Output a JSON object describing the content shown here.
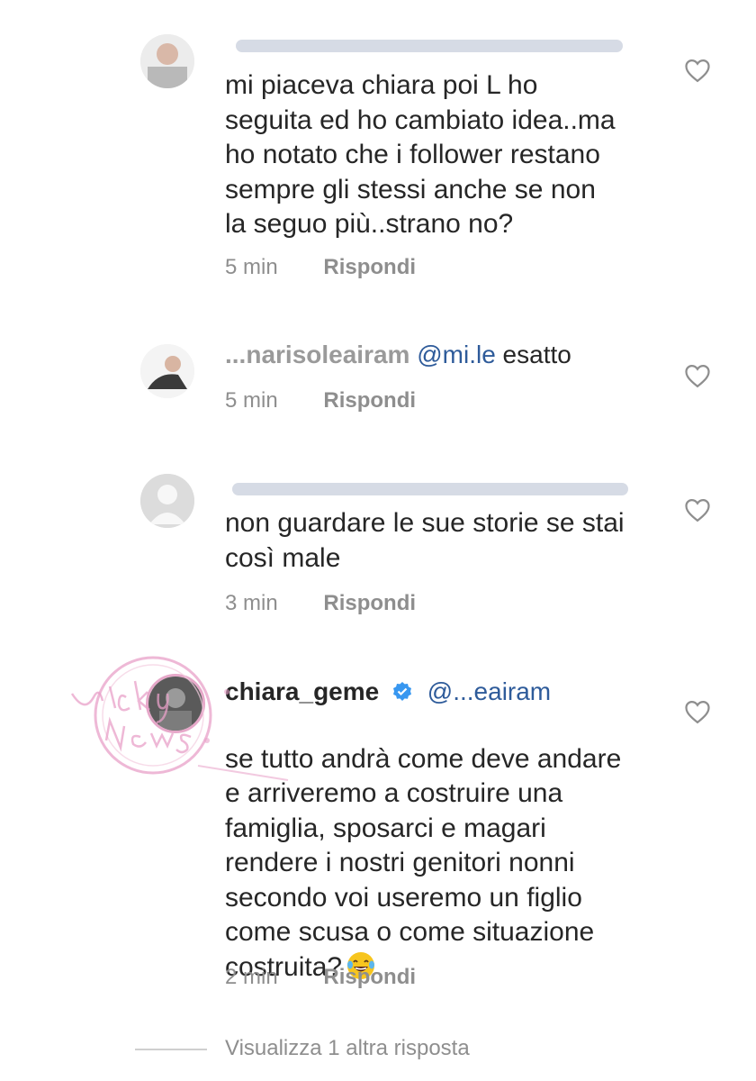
{
  "comments": [
    {
      "text": "mi piaceva chiara poi L ho\nseguita ed ho cambiato idea..ma\nho notato che i follower restano\nsempre gli stessi anche se non\nla seguo più..strano no?",
      "time": "5 min",
      "reply_label": "Rispondi"
    },
    {
      "username": "...narisoleairam",
      "mention": "@mi.le",
      "text": "esatto",
      "time": "5 min",
      "reply_label": "Rispondi"
    },
    {
      "text": "non guardare le sue storie se stai\ncosì male",
      "time": "3 min",
      "reply_label": "Rispondi"
    },
    {
      "username": "chiara_geme",
      "mention": "@...eairam",
      "text": "se tutto andrà come deve andare\ne arriveremo a costruire una\nfamiglia, sposarci e magari\nrendere i nostri genitori nonni\nsecondo voi useremo un figlio\ncome scusa o come situazione\ncostruita?",
      "time": "2 min",
      "reply_label": "Rispondi"
    }
  ],
  "view_more": "Visualizza 1 altra risposta",
  "watermark_text": "Vicky News",
  "colors": {
    "text": "#262626",
    "muted": "#8e8e8e",
    "mention": "#2e5b9a",
    "verified": "#3897f0",
    "watermark": "#e8a0c8"
  },
  "icons": {
    "like": "heart-outline-icon",
    "verified": "verified-badge-icon",
    "emoji": "laughing-tears-emoji-icon"
  }
}
